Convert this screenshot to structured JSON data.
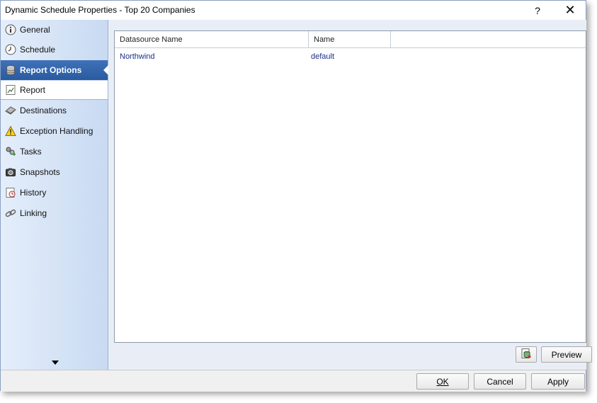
{
  "window": {
    "title": "Dynamic Schedule Properties - Top 20 Companies",
    "help_label": "?",
    "close_label": "✕"
  },
  "sidebar": {
    "items": [
      {
        "label": "General",
        "icon": "info-icon"
      },
      {
        "label": "Schedule",
        "icon": "clock-icon"
      },
      {
        "label": "Report Options",
        "icon": "database-icon",
        "active": true
      },
      {
        "label": "Report",
        "icon": "report-chart-icon",
        "sub": true
      },
      {
        "label": "Destinations",
        "icon": "destinations-icon"
      },
      {
        "label": "Exception Handling",
        "icon": "warning-icon"
      },
      {
        "label": "Tasks",
        "icon": "tasks-icon"
      },
      {
        "label": "Snapshots",
        "icon": "camera-icon"
      },
      {
        "label": "History",
        "icon": "history-icon"
      },
      {
        "label": "Linking",
        "icon": "link-icon"
      }
    ]
  },
  "grid": {
    "columns": [
      "Datasource Name",
      "Name"
    ],
    "rows": [
      [
        "Northwind",
        "default"
      ]
    ]
  },
  "actions": {
    "preview_label": "Preview",
    "ok_label": "OK",
    "cancel_label": "Cancel",
    "apply_label": "Apply"
  },
  "colors": {
    "active_nav": "#2f62aa",
    "sidebar_bg": "#d6e4f7",
    "content_bg": "#e9eef6",
    "cell_text": "#1b2f8a"
  }
}
